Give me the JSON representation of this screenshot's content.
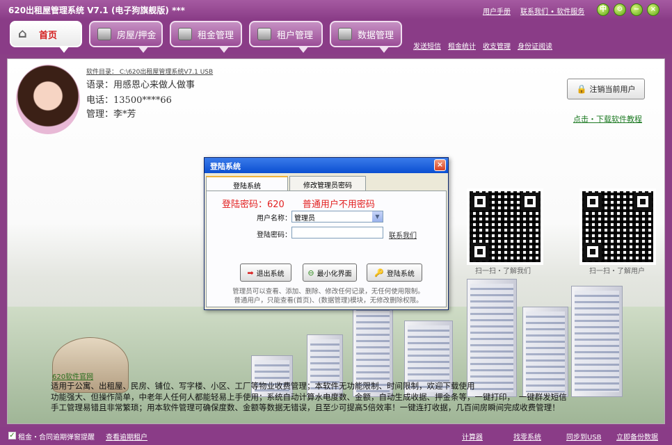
{
  "app": {
    "title": "620出租屋管理系统 V7.1 (电子狗旗舰版) ***",
    "top_links": [
      "用户手册",
      "联系我们 • 软件服务"
    ],
    "window_icons": [
      "中",
      "⚙",
      "−",
      "×"
    ]
  },
  "nav": {
    "tabs": [
      {
        "label": "首页",
        "icon": "home-icon"
      },
      {
        "label": "房屋/押金",
        "icon": "monitor-icon"
      },
      {
        "label": "租金管理",
        "icon": "card-icon"
      },
      {
        "label": "租户管理",
        "icon": "user-icon"
      },
      {
        "label": "数据管理",
        "icon": "disk-icon"
      }
    ],
    "sub_links": [
      "发送短信",
      "租金统计",
      "收支管理",
      "身份证阅读"
    ]
  },
  "profile": {
    "directory": "软件目录： C:\\620出租屋管理系统V7.1 USB",
    "motto": "语录：用感恩心来做人做事",
    "phone": "电话：13500****66",
    "manager": "管理：李*芳"
  },
  "actions": {
    "logout": "注销当前用户",
    "tutorial": "点击・下载软件教程"
  },
  "qr": {
    "caption_left": "扫一扫・了解我们",
    "caption_right": "扫一扫・了解用户"
  },
  "login_dialog": {
    "title": "登陆系统",
    "tabs": [
      "登陆系统",
      "修改管理员密码"
    ],
    "password_hint": "登陆密码：620　　普通用户不用密码",
    "username_label": "用户名称：",
    "username_value": "管理员",
    "password_label": "登陆密码：",
    "contact_link": "联系我们",
    "buttons": [
      "退出系统",
      "最小化界面",
      "登陆系统"
    ],
    "notes": [
      "管理员可以查看、添加、删除、修改任何记录，无任何使用限制。",
      "普通用户，只能查看(首页)、(数据管理)模块，无修改删除权限。"
    ]
  },
  "description": {
    "official_link": "620软件官网",
    "lines": [
      "适用于公寓、出租屋、民房、铺位、写字楼、小区、工厂等物业收费管理；本软件无功能限制、时间限制，欢迎下载使用",
      "功能强大、但操作简单，中老年人任何人都能轻易上手使用；系统自动计算水电度数、金额，自动生成收据、押金条等，一键打印，　一键群发短信",
      "手工管理易错且非常繁琐；用本软件管理可确保度数、金额等数据无错误，且至少可提高5倍效率！一键连打收据，几百间房瞬间完成收费管理！"
    ]
  },
  "status_bar": {
    "reminder_label": "租金・合同逾期弹窗提醒",
    "view_overdue": "查看逾期租户",
    "links": [
      "计算器",
      "找零系统",
      "同步到USB",
      "立即备份数据"
    ]
  }
}
